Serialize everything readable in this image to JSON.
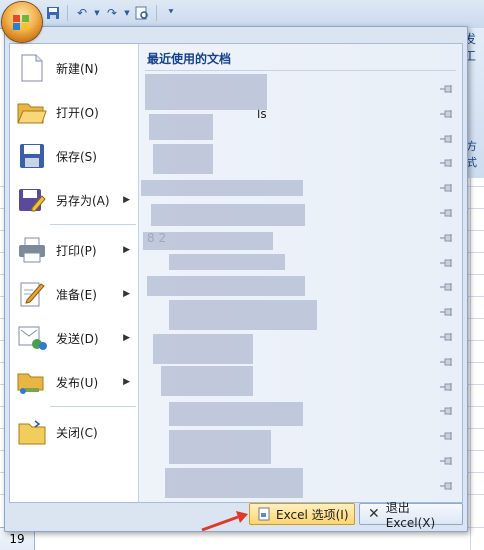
{
  "background": {
    "ribbon_tab_fragment": "发工",
    "ribbon_fragment": "方式",
    "row_header": "19"
  },
  "menu": {
    "items": [
      {
        "label": "新建(N)",
        "icon": "new-document-icon",
        "has_submenu": false
      },
      {
        "label": "打开(O)",
        "icon": "open-folder-icon",
        "has_submenu": false
      },
      {
        "label": "保存(S)",
        "icon": "save-icon",
        "has_submenu": false
      },
      {
        "label": "另存为(A)",
        "icon": "save-as-icon",
        "has_submenu": true
      },
      {
        "label": "打印(P)",
        "icon": "printer-icon",
        "has_submenu": true
      },
      {
        "label": "准备(E)",
        "icon": "prepare-icon",
        "has_submenu": true
      },
      {
        "label": "发送(D)",
        "icon": "send-icon",
        "has_submenu": true
      },
      {
        "label": "发布(U)",
        "icon": "publish-icon",
        "has_submenu": true
      },
      {
        "label": "关闭(C)",
        "icon": "close-folder-icon",
        "has_submenu": false
      }
    ],
    "recent_title": "最近使用的文档",
    "recent_items": [
      {
        "text": ""
      },
      {
        "text": "ls"
      },
      {
        "text": ""
      },
      {
        "text": ""
      },
      {
        "text": ""
      },
      {
        "text": ""
      },
      {
        "text": "8  2"
      },
      {
        "text": ""
      },
      {
        "text": ""
      },
      {
        "text": ""
      },
      {
        "text": ""
      },
      {
        "text": ""
      },
      {
        "text": ""
      },
      {
        "text": ""
      },
      {
        "text": ""
      },
      {
        "text": ""
      },
      {
        "text": ""
      }
    ],
    "footer": {
      "options_label": "Excel 选项(I)",
      "exit_label": "退出 Excel(X)"
    }
  },
  "colors": {
    "accent": "#15428b",
    "highlight": "#ffd66e",
    "arrow": "#e0392b"
  }
}
